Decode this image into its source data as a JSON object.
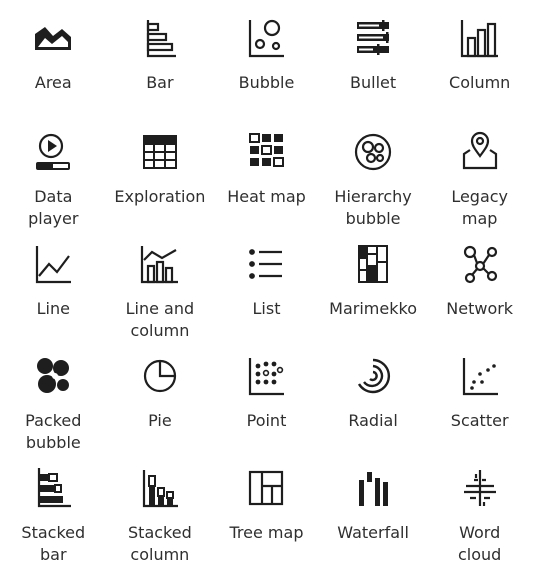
{
  "tiles": [
    {
      "id": "area",
      "label": "Area",
      "icon": "area-chart-icon"
    },
    {
      "id": "bar",
      "label": "Bar",
      "icon": "bar-chart-icon"
    },
    {
      "id": "bubble",
      "label": "Bubble",
      "icon": "bubble-chart-icon"
    },
    {
      "id": "bullet",
      "label": "Bullet",
      "icon": "bullet-chart-icon"
    },
    {
      "id": "column",
      "label": "Column",
      "icon": "column-chart-icon"
    },
    {
      "id": "data-player",
      "label": "Data\nplayer",
      "icon": "data-player-icon"
    },
    {
      "id": "exploration",
      "label": "Exploration",
      "icon": "exploration-table-icon"
    },
    {
      "id": "heat-map",
      "label": "Heat map",
      "icon": "heat-map-icon"
    },
    {
      "id": "hierarchy-bubble",
      "label": "Hierarchy\nbubble",
      "icon": "hierarchy-bubble-icon"
    },
    {
      "id": "legacy-map",
      "label": "Legacy\nmap",
      "icon": "legacy-map-icon"
    },
    {
      "id": "line",
      "label": "Line",
      "icon": "line-chart-icon"
    },
    {
      "id": "line-and-column",
      "label": "Line and\ncolumn",
      "icon": "line-and-column-icon"
    },
    {
      "id": "list",
      "label": "List",
      "icon": "list-icon"
    },
    {
      "id": "marimekko",
      "label": "Marimekko",
      "icon": "marimekko-icon"
    },
    {
      "id": "network",
      "label": "Network",
      "icon": "network-icon"
    },
    {
      "id": "packed-bubble",
      "label": "Packed\nbubble",
      "icon": "packed-bubble-icon"
    },
    {
      "id": "pie",
      "label": "Pie",
      "icon": "pie-chart-icon"
    },
    {
      "id": "point",
      "label": "Point",
      "icon": "point-chart-icon"
    },
    {
      "id": "radial",
      "label": "Radial",
      "icon": "radial-chart-icon"
    },
    {
      "id": "scatter",
      "label": "Scatter",
      "icon": "scatter-chart-icon"
    },
    {
      "id": "stacked-bar",
      "label": "Stacked\nbar",
      "icon": "stacked-bar-icon"
    },
    {
      "id": "stacked-column",
      "label": "Stacked\ncolumn",
      "icon": "stacked-column-icon"
    },
    {
      "id": "tree-map",
      "label": "Tree map",
      "icon": "tree-map-icon"
    },
    {
      "id": "waterfall",
      "label": "Waterfall",
      "icon": "waterfall-icon"
    },
    {
      "id": "word-cloud",
      "label": "Word\ncloud",
      "icon": "word-cloud-icon"
    }
  ]
}
